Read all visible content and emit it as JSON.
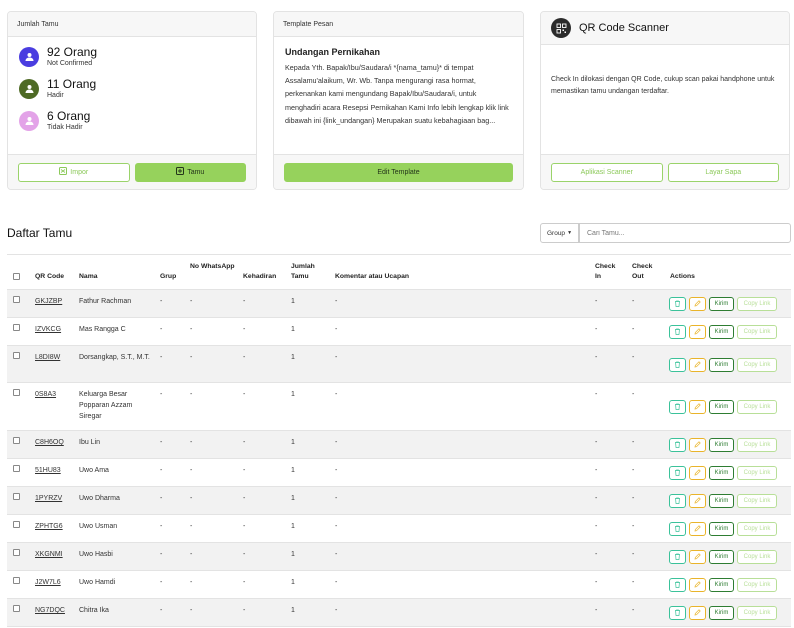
{
  "stats_card": {
    "header": "Jumlah Tamu",
    "items": [
      {
        "count": "92 Orang",
        "label": "Not Confirmed",
        "color": "#4a3de0"
      },
      {
        "count": "11 Orang",
        "label": "Hadir",
        "color": "#4e6a25"
      },
      {
        "count": "6 Orang",
        "label": "Tidak Hadir",
        "color": "#e3a3e8"
      }
    ],
    "impor_label": "Impor",
    "tamu_label": "Tamu"
  },
  "template_card": {
    "header": "Template Pesan",
    "title": "Undangan Pernikahan",
    "body": "Kepada Yth. Bapak/Ibu/Saudara/i *{nama_tamu}* di tempat Assalamu'alaikum, Wr. Wb. Tanpa mengurangi rasa hormat, perkenankan kami mengundang Bapak/Ibu/Saudara/i, untuk menghadiri acara Resepsi Pernikahan Kami Info lebih lengkap klik link dibawah ini {link_undangan} Merupakan suatu kebahagiaan bag...",
    "edit_label": "Edit Template"
  },
  "qr_card": {
    "title": "QR Code Scanner",
    "text": "Check In dilokasi dengan QR Code, cukup scan pakai handphone untuk memastikan tamu undangan terdaftar.",
    "aplikasi_label": "Aplikasi Scanner",
    "layar_label": "Layar Sapa"
  },
  "guest_list": {
    "title": "Daftar Tamu",
    "group_label": "Group",
    "search_placeholder": "Cari Tamu...",
    "columns": {
      "qr": "QR Code",
      "nama": "Nama",
      "grup": "Grup",
      "wa": "No WhatsApp",
      "kehadiran": "Kehadiran",
      "jumlah": "Jumlah Tamu",
      "komentar": "Komentar atau Ucapan",
      "checkin": "Check In",
      "checkout": "Check Out",
      "actions": "Actions"
    },
    "action_labels": {
      "kirim": "Kirim",
      "copy": "Copy Link"
    },
    "rows": [
      {
        "qr": "GKJZBP",
        "nama": "Fathur Rachman",
        "grup": "-",
        "wa": "-",
        "kehadiran": "-",
        "jumlah": "1",
        "komentar": "-",
        "checkin": "-",
        "checkout": "-"
      },
      {
        "qr": "IZVKCG",
        "nama": "Mas Rangga C",
        "grup": "-",
        "wa": "-",
        "kehadiran": "-",
        "jumlah": "1",
        "komentar": "-",
        "checkin": "-",
        "checkout": "-"
      },
      {
        "qr": "L8DI8W",
        "nama": "Dorsangkap, S.T., M.T.",
        "grup": "-",
        "wa": "-",
        "kehadiran": "-",
        "jumlah": "1",
        "komentar": "-",
        "checkin": "-",
        "checkout": "-"
      },
      {
        "qr": "0S8A3",
        "nama": "Keluarga Besar Popparan Azzam Siregar",
        "grup": "-",
        "wa": "-",
        "kehadiran": "-",
        "jumlah": "1",
        "komentar": "-",
        "checkin": "-",
        "checkout": "-"
      },
      {
        "qr": "C8H6OQ",
        "nama": "Ibu Lin",
        "grup": "-",
        "wa": "-",
        "kehadiran": "-",
        "jumlah": "1",
        "komentar": "-",
        "checkin": "-",
        "checkout": "-"
      },
      {
        "qr": "51HU83",
        "nama": "Uwo Ama",
        "grup": "-",
        "wa": "-",
        "kehadiran": "-",
        "jumlah": "1",
        "komentar": "-",
        "checkin": "-",
        "checkout": "-"
      },
      {
        "qr": "1PYRZV",
        "nama": "Uwo Dharma",
        "grup": "-",
        "wa": "-",
        "kehadiran": "-",
        "jumlah": "1",
        "komentar": "-",
        "checkin": "-",
        "checkout": "-"
      },
      {
        "qr": "ZPHTG6",
        "nama": "Uwo Usman",
        "grup": "-",
        "wa": "-",
        "kehadiran": "-",
        "jumlah": "1",
        "komentar": "-",
        "checkin": "-",
        "checkout": "-"
      },
      {
        "qr": "XKGNMI",
        "nama": "Uwo Hasbi",
        "grup": "-",
        "wa": "-",
        "kehadiran": "-",
        "jumlah": "1",
        "komentar": "-",
        "checkin": "-",
        "checkout": "-"
      },
      {
        "qr": "J2W7L6",
        "nama": "Uwo Hamdi",
        "grup": "-",
        "wa": "-",
        "kehadiran": "-",
        "jumlah": "1",
        "komentar": "-",
        "checkin": "-",
        "checkout": "-"
      },
      {
        "qr": "NG7DQC",
        "nama": "Chitra Ika",
        "grup": "-",
        "wa": "-",
        "kehadiran": "-",
        "jumlah": "1",
        "komentar": "-",
        "checkin": "-",
        "checkout": "-"
      }
    ]
  }
}
